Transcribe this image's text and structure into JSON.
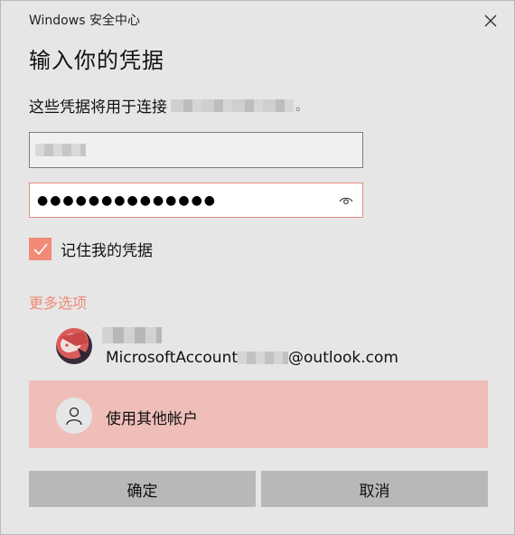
{
  "window": {
    "title": "Windows 安全中心"
  },
  "dialog": {
    "heading": "输入你的凭据",
    "subtitle_prefix": "这些凭据将用于连接",
    "subtitle_suffix": "。"
  },
  "fields": {
    "password_mask": "●●●●●●●●●●●●●●"
  },
  "remember": {
    "label": "记住我的凭据",
    "checked": true
  },
  "more_options": {
    "label": "更多选项"
  },
  "accounts": {
    "microsoft": {
      "email_prefix": "MicrosoftAccount",
      "email_suffix": "@outlook.com"
    },
    "other": {
      "label": "使用其他帐户"
    }
  },
  "buttons": {
    "ok": "确定",
    "cancel": "取消"
  },
  "colors": {
    "accent": "#f28a78",
    "selected_row": "#f0beb9",
    "background": "#e6e6e6",
    "button": "#b8b8b8"
  }
}
